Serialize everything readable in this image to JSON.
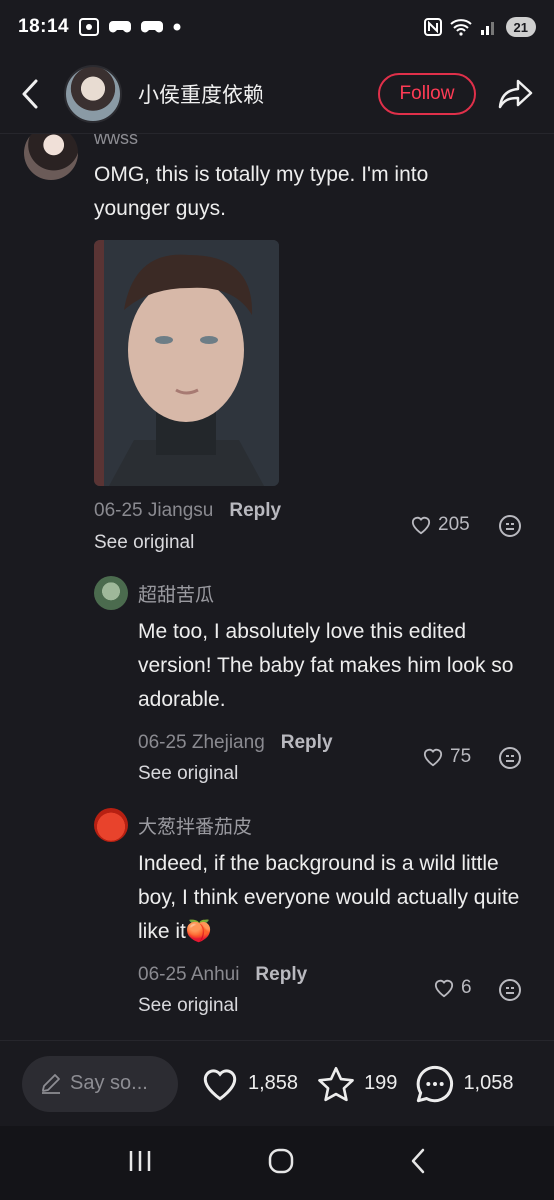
{
  "status_bar": {
    "time": "18:14",
    "battery": "21"
  },
  "header": {
    "author_name": "小侯重度依赖",
    "follow_label": "Follow"
  },
  "comments": {
    "top": {
      "username": "wwss",
      "text": "OMG, this is totally my type. I'm into younger guys.",
      "date_location": "06-25 Jiangsu",
      "reply_label": "Reply",
      "see_original": "See original",
      "likes": "205"
    },
    "replies": [
      {
        "username": "超甜苦瓜",
        "text": "Me too, I absolutely love this edited version! The baby fat makes him look so adorable.",
        "date_location": "06-25 Zhejiang",
        "reply_label": "Reply",
        "see_original": "See original",
        "likes": "75"
      },
      {
        "username": "大葱拌番茄皮",
        "text": "Indeed, if the background is a wild little boy, I think everyone would actually quite like it",
        "emoji": "🍑",
        "date_location": "06-25 Anhui",
        "reply_label": "Reply",
        "see_original": "See original",
        "likes": "6"
      }
    ]
  },
  "bottom_bar": {
    "input_placeholder": "Say so...",
    "likes_count": "1,858",
    "stars_count": "199",
    "comments_count": "1,058"
  },
  "colors": {
    "background": "#1a1a1f",
    "accent": "#ff3b55"
  }
}
